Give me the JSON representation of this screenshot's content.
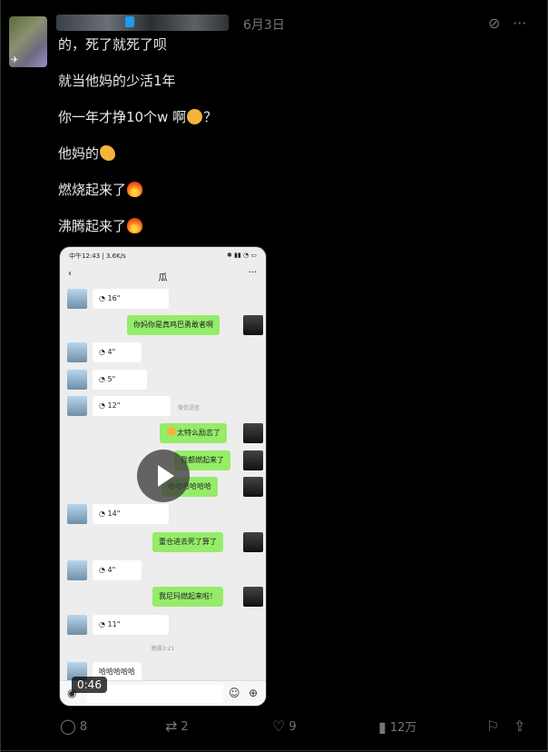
{
  "post": {
    "date": "6月3日",
    "lines": [
      "的，死了就死了呗",
      "就当他妈的少活1年",
      "你一年才挣10个w 啊",
      "他妈的",
      "燃烧起来了",
      "沸腾起来了"
    ],
    "line_suffix_q": "？",
    "video_duration": "0:46"
  },
  "phone": {
    "status_left": "中午12:43 | 3.6K/s",
    "chat_title": "瓜",
    "messages": [
      {
        "dir": "in",
        "text": "16\""
      },
      {
        "dir": "out",
        "text": "你妈你是真鸡巴勇敢者啊"
      },
      {
        "dir": "in",
        "text": "4\""
      },
      {
        "dir": "in",
        "text": "5\""
      },
      {
        "dir": "in",
        "text": "12\""
      },
      {
        "dir": "out",
        "text": "太特么励志了"
      },
      {
        "dir": "out",
        "text": "我都燃起来了"
      },
      {
        "dir": "out",
        "text": "哈哈哈哈哈哈"
      },
      {
        "dir": "in",
        "text": "14\""
      },
      {
        "dir": "out",
        "text": "重仓进去死了算了"
      },
      {
        "dir": "in",
        "text": "4\""
      },
      {
        "dir": "out",
        "text": "我尼玛燃起来啦！"
      },
      {
        "dir": "in",
        "text": "11\""
      },
      {
        "dir": "in",
        "text": "哈哈哈哈哈"
      }
    ],
    "time_stamp": "晚晨3:21",
    "side_note": "微信语音"
  },
  "actions": {
    "reply_count": "8",
    "repost_count": "2",
    "like_count": "9",
    "views_count": "12万"
  },
  "icons": [
    "grok-icon",
    "more-icon",
    "reply-icon",
    "repost-icon",
    "like-icon",
    "views-icon",
    "bookmark-icon",
    "share-icon"
  ]
}
